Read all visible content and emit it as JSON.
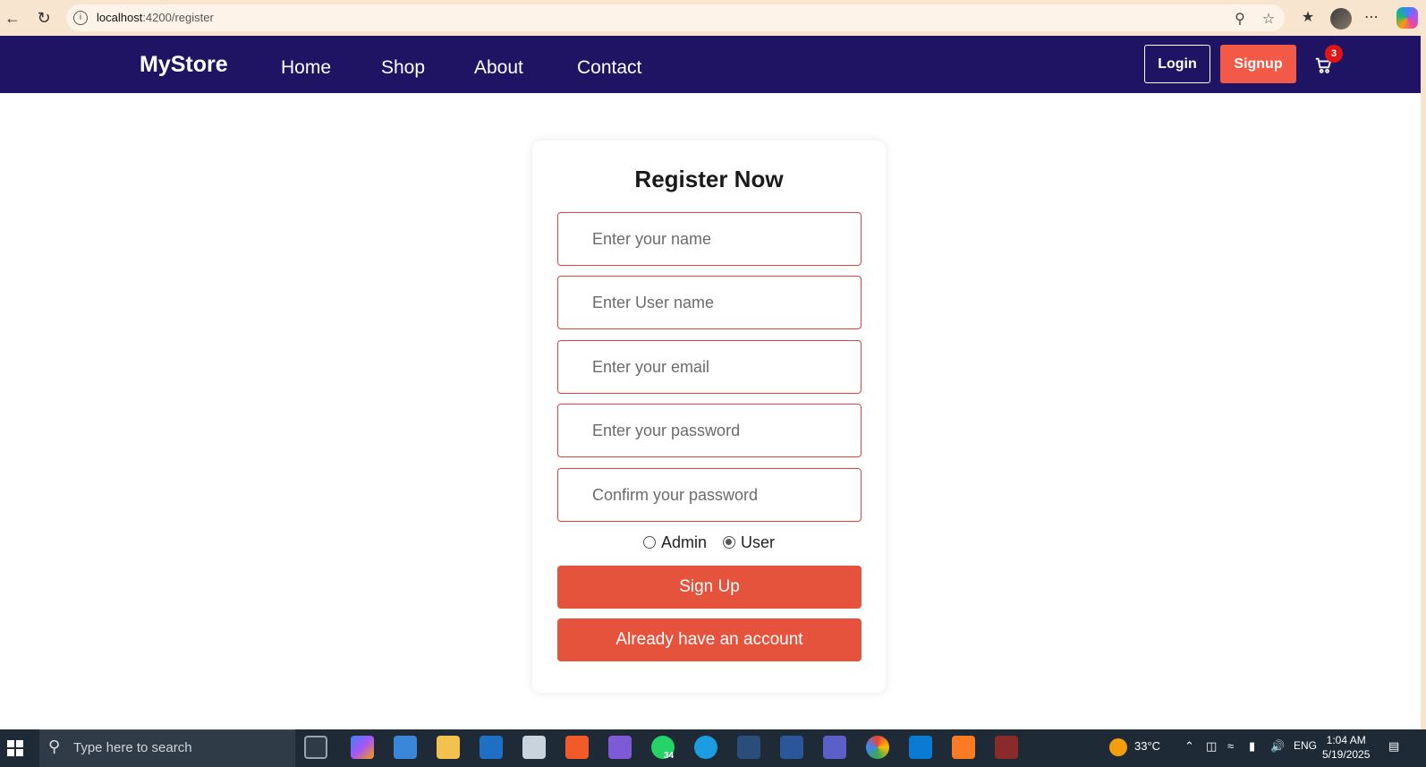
{
  "browser": {
    "url_host": "localhost",
    "url_rest": ":4200/register",
    "icons": [
      "back-icon",
      "refresh-icon",
      "site-info-icon",
      "zoom-icon",
      "favorite-star-icon",
      "favorites-icon",
      "profile-avatar",
      "more-icon",
      "copilot-icon"
    ]
  },
  "navbar": {
    "brand": "MyStore",
    "links": [
      "Home",
      "Shop",
      "About",
      "Contact"
    ],
    "login_label": "Login",
    "signup_label": "Signup",
    "cart_count": "3"
  },
  "register": {
    "title": "Register Now",
    "fields": {
      "name_placeholder": "Enter your name",
      "username_placeholder": "Enter User name",
      "email_placeholder": "Enter your email",
      "password_placeholder": "Enter your password",
      "confirm_placeholder": "Confirm your password"
    },
    "roles": [
      {
        "label": "Admin",
        "checked": false
      },
      {
        "label": "User",
        "checked": true
      }
    ],
    "signup_button": "Sign Up",
    "login_link_button": "Already have an account"
  },
  "taskbar": {
    "search_placeholder": "Type here to search",
    "whatsapp_badge": "34",
    "weather": "33°C",
    "language": "ENG",
    "time": "1:04 AM",
    "date": "5/19/2025"
  },
  "colors": {
    "navbar_bg": "#1f1463",
    "accent": "#e5533d",
    "signup_nav": "#f25a47",
    "badge": "#e01515"
  }
}
